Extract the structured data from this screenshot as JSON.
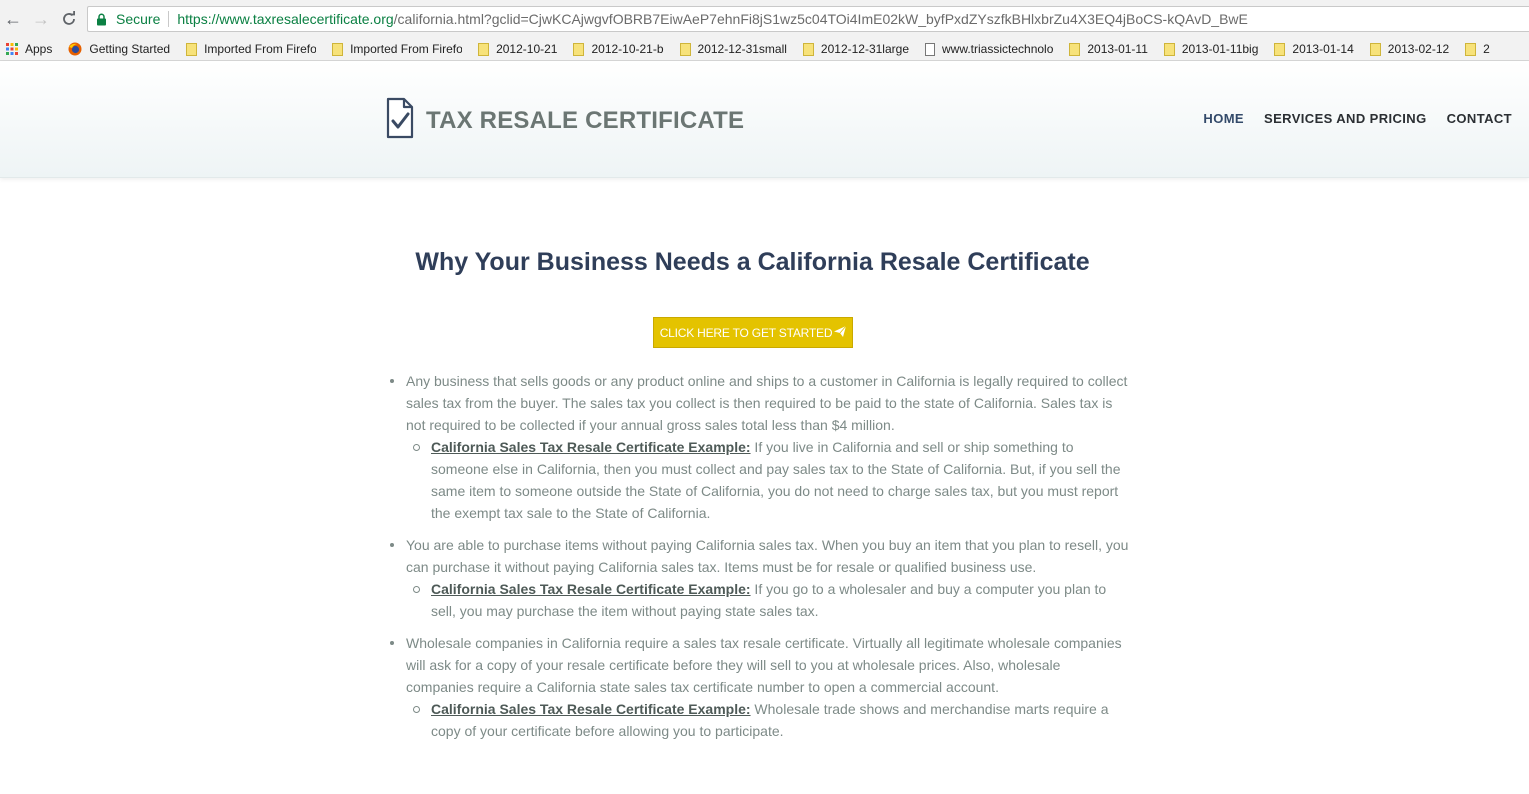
{
  "browser": {
    "secure_label": "Secure",
    "url_host": "https://www.taxresalecertificate.org",
    "url_path": "/california.html?gclid=CjwKCAjwgvfOBRB7EiwAeP7ehnFi8jS1wz5c04TOi4ImE02kW_byfPxdZYszfkBHlxbrZu4X3EQ4jBoCS-kQAvD_BwE"
  },
  "bookmarks": [
    {
      "label": "Apps",
      "icon": "apps-grid-icon"
    },
    {
      "label": "Getting Started",
      "icon": "firefox-icon"
    },
    {
      "label": "Imported From Firefo",
      "icon": "folder-icon"
    },
    {
      "label": "Imported From Firefo",
      "icon": "folder-icon"
    },
    {
      "label": "2012-10-21",
      "icon": "folder-icon"
    },
    {
      "label": "2012-10-21-b",
      "icon": "folder-icon"
    },
    {
      "label": "2012-12-31small",
      "icon": "folder-icon"
    },
    {
      "label": "2012-12-31large",
      "icon": "folder-icon"
    },
    {
      "label": "www.triassictechnolo",
      "icon": "page-icon"
    },
    {
      "label": "2013-01-11",
      "icon": "folder-icon"
    },
    {
      "label": "2013-01-11big",
      "icon": "folder-icon"
    },
    {
      "label": "2013-01-14",
      "icon": "folder-icon"
    },
    {
      "label": "2013-02-12",
      "icon": "folder-icon"
    },
    {
      "label": "2",
      "icon": "folder-icon"
    }
  ],
  "site": {
    "logo_text": "TAX RESALE CERTIFICATE",
    "nav": [
      {
        "label": "HOME"
      },
      {
        "label": "SERVICES AND PRICING"
      },
      {
        "label": "CONTACT"
      }
    ]
  },
  "main": {
    "title": "Why Your Business Needs a California Resale Certificate",
    "cta_label": "CLICK HERE TO GET STARTED",
    "points": [
      {
        "text": "Any business that sells goods or any product online and ships to a customer in California is legally required to collect sales tax from the buyer. The sales tax you collect is then required to be paid to the state of California. Sales tax is not required to be collected if your annual gross sales total less than $4 million.",
        "example_label": "California Sales Tax Resale Certificate Example:",
        "example_text": " If you live in California and sell or ship something to someone else in California, then you must collect and pay sales tax to the State of California. But, if you sell the same item to someone outside the State of California, you do not need to charge sales tax, but you must report the exempt tax sale to the State of California."
      },
      {
        "text": "You are able to purchase items without paying California sales tax. When you buy an item that you plan to resell, you can purchase it without paying California sales tax. Items must be for resale or qualified business use.",
        "example_label": "California Sales Tax Resale Certificate Example:",
        "example_text": " If you go to a wholesaler and buy a computer you plan to sell, you may purchase the item without paying state sales tax."
      },
      {
        "text": "Wholesale companies in California require a sales tax resale certificate. Virtually all legitimate wholesale companies will ask for a copy of your resale certificate before they will sell to you at wholesale prices. Also, wholesale companies require a California state sales tax certificate number to open a commercial account.",
        "example_label": "California Sales Tax Resale Certificate Example:",
        "example_text": " Wholesale trade shows and merchandise marts require a copy of your certificate before allowing you to participate."
      }
    ]
  },
  "colors": {
    "accent_yellow": "#e4c300",
    "title_navy": "#2f3e59",
    "body_gray": "#7d8a87",
    "secure_green": "#0b8043"
  }
}
